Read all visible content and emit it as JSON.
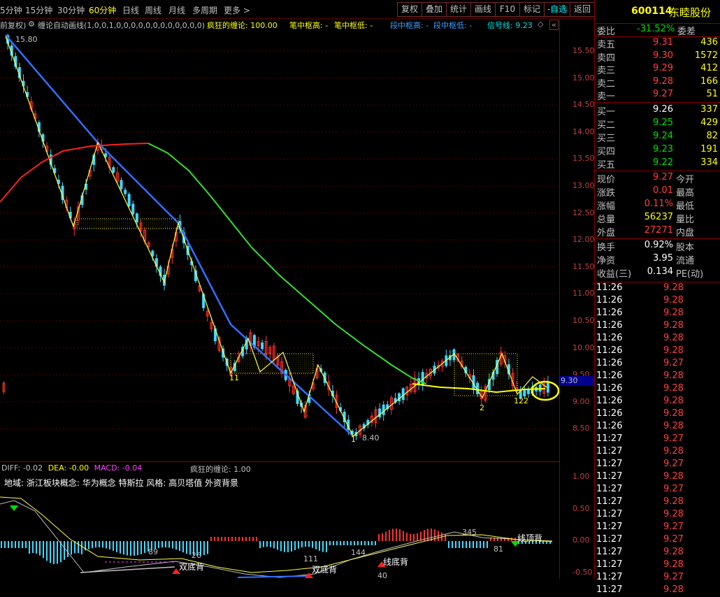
{
  "toolbar": {
    "left_items": [
      "5分钟",
      "15分钟",
      "30分钟",
      "60分钟",
      "日线",
      "周线",
      "月线",
      "多周期",
      "更多 >"
    ],
    "active": "60分钟",
    "right_items": [
      "复权",
      "叠加",
      "统计",
      "画线",
      "F10",
      "标记",
      "-自选",
      "返回"
    ]
  },
  "infobar": {
    "fq": "前复权)",
    "indicator": "缠论自动画线(1,0,0,1,0,0,0,0,0,0,0,0,0,0,0,0)",
    "crazy": "疯狂的缠论: 100.00",
    "bi_high": "笔中枢高: -",
    "bi_low": "笔中枢低: -",
    "duan_high": "段中枢高: -",
    "duan_low": "段中枢低: -",
    "signal": "信号线: 9.23",
    "signal_icon": "diamond-icon"
  },
  "price_axis": {
    "ticks": [
      "15.50",
      "15.00",
      "14.50",
      "14.00",
      "13.50",
      "13.00",
      "12.50",
      "12.00",
      "11.50",
      "11.00",
      "10.50",
      "10.00",
      "9.50",
      "9.00",
      "8.50"
    ],
    "current_tag": "9.30"
  },
  "chart_labels": {
    "high": "15.80",
    "low": "8.40",
    "n11": "11",
    "n1": "1",
    "n2": "2",
    "n122": "122"
  },
  "lower": {
    "macd_title_diff": "DIFF: -0.02",
    "macd_title_dea": "DEA: -0.00",
    "macd_title_macd": "MACD: -0.04",
    "crazy": "疯狂的缠论: 1.00",
    "info": "地域: 浙江板块概念: 华为概念 特斯拉 风格: 高贝塔值 外资背景",
    "ticks": [
      "1.00",
      "0.50",
      "0.00",
      "-0.50"
    ],
    "labels": [
      "89",
      "26",
      "双底背",
      "111",
      "双底背",
      "144",
      "线底背",
      "40",
      "345",
      "81",
      "线顶背"
    ]
  },
  "right": {
    "code": "600114",
    "name": "东睦股份",
    "weibi_label": "委比",
    "weibi_value": "-31.52%",
    "weicha_label": "委差",
    "sell": [
      {
        "label": "卖五",
        "price": "9.31",
        "vol": "436"
      },
      {
        "label": "卖四",
        "price": "9.30",
        "vol": "1572"
      },
      {
        "label": "卖三",
        "price": "9.29",
        "vol": "412"
      },
      {
        "label": "卖二",
        "price": "9.28",
        "vol": "166"
      },
      {
        "label": "卖一",
        "price": "9.27",
        "vol": "51"
      }
    ],
    "buy": [
      {
        "label": "买一",
        "price": "9.26",
        "vol": "337",
        "color": "white"
      },
      {
        "label": "买二",
        "price": "9.25",
        "vol": "429",
        "color": "green"
      },
      {
        "label": "买三",
        "price": "9.24",
        "vol": "82",
        "color": "green"
      },
      {
        "label": "买四",
        "price": "9.23",
        "vol": "191",
        "color": "green"
      },
      {
        "label": "买五",
        "price": "9.22",
        "vol": "334",
        "color": "green"
      }
    ],
    "stats1": [
      {
        "l": "现价",
        "v": "9.27",
        "c": "red",
        "r": "今开"
      },
      {
        "l": "涨跌",
        "v": "0.01",
        "c": "red",
        "r": "最高"
      },
      {
        "l": "涨幅",
        "v": "0.11%",
        "c": "red",
        "r": "最低"
      },
      {
        "l": "总量",
        "v": "56237",
        "c": "yel",
        "r": "量比"
      },
      {
        "l": "外盘",
        "v": "27271",
        "c": "red",
        "r": "内盘"
      }
    ],
    "stats2": [
      {
        "l": "换手",
        "v": "0.92%",
        "c": "white",
        "r": "股本"
      },
      {
        "l": "净资",
        "v": "3.95",
        "c": "white",
        "r": "流通"
      },
      {
        "l": "收益(三)",
        "v": "0.134",
        "c": "white",
        "r": "PE(动)"
      }
    ],
    "ticks": [
      {
        "t": "11:26",
        "p": "9.28",
        "c": "red"
      },
      {
        "t": "11:26",
        "p": "9.28",
        "c": "red"
      },
      {
        "t": "11:26",
        "p": "9.28",
        "c": "red"
      },
      {
        "t": "11:26",
        "p": "9.28",
        "c": "red"
      },
      {
        "t": "11:26",
        "p": "9.28",
        "c": "red"
      },
      {
        "t": "11:26",
        "p": "9.28",
        "c": "red"
      },
      {
        "t": "11:26",
        "p": "9.27",
        "c": "red"
      },
      {
        "t": "11:26",
        "p": "9.28",
        "c": "red"
      },
      {
        "t": "11:26",
        "p": "9.28",
        "c": "red"
      },
      {
        "t": "11:26",
        "p": "9.28",
        "c": "red"
      },
      {
        "t": "11:26",
        "p": "9.28",
        "c": "red"
      },
      {
        "t": "11:26",
        "p": "9.28",
        "c": "red"
      },
      {
        "t": "11:27",
        "p": "9.27",
        "c": "red"
      },
      {
        "t": "11:27",
        "p": "9.28",
        "c": "red"
      },
      {
        "t": "11:27",
        "p": "9.27",
        "c": "red"
      },
      {
        "t": "11:27",
        "p": "9.28",
        "c": "red"
      },
      {
        "t": "11:27",
        "p": "9.27",
        "c": "red"
      },
      {
        "t": "11:27",
        "p": "9.28",
        "c": "red"
      },
      {
        "t": "11:27",
        "p": "9.28",
        "c": "red"
      },
      {
        "t": "11:27",
        "p": "9.27",
        "c": "red"
      },
      {
        "t": "11:27",
        "p": "9.27",
        "c": "red"
      },
      {
        "t": "11:27",
        "p": "9.28",
        "c": "red"
      },
      {
        "t": "11:27",
        "p": "9.28",
        "c": "red"
      },
      {
        "t": "11:27",
        "p": "9.27",
        "c": "red"
      },
      {
        "t": "11:27",
        "p": "9.28",
        "c": "red"
      }
    ]
  }
}
